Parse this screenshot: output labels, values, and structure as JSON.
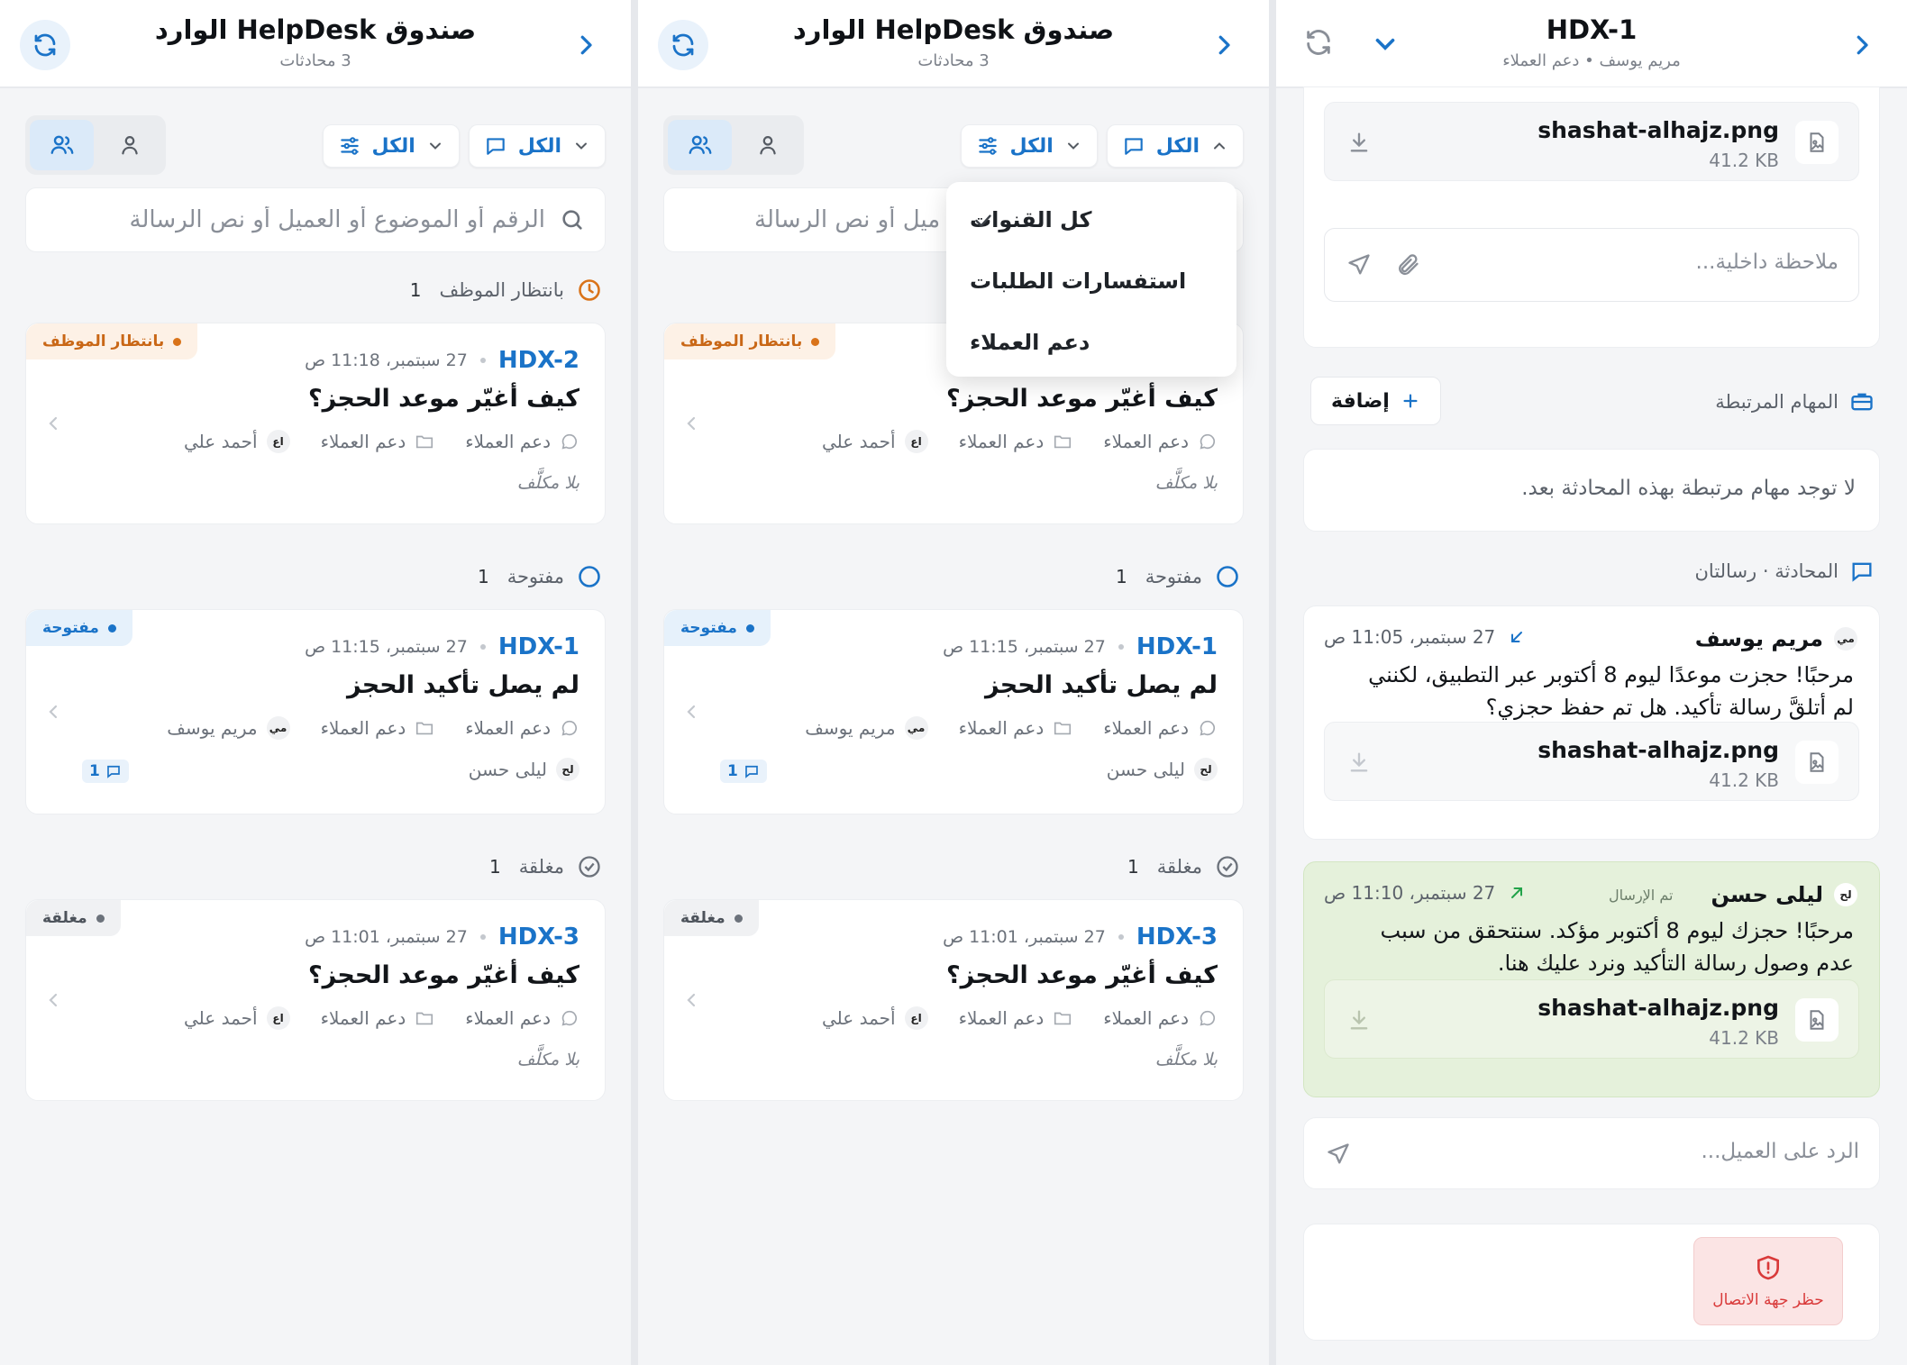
{
  "inbox": {
    "title": "صندوق HelpDesk الوارد",
    "subtitle": "3 محادثات",
    "channel_filter": "الكل",
    "status_filter": "الكل",
    "search_placeholder": "الرقم أو الموضوع أو العميل أو نص الرسالة",
    "search_placeholder_partial": "ميل أو نص الرسالة",
    "sections": [
      {
        "title": "بانتظار الموظف",
        "count": "1"
      },
      {
        "title": "مفتوحة",
        "count": "1"
      },
      {
        "title": "مغلقة",
        "count": "1"
      }
    ],
    "tickets": [
      {
        "id": "HDX-2",
        "time": "27 سبتمبر، 11:18 ص",
        "subject": "كيف أغيّر موعد الحجز؟",
        "channel": "دعم العملاء",
        "folder": "دعم العملاء",
        "customer_initials": "اع",
        "customer": "أحمد علي",
        "assignee": "بلا مكلَّف",
        "badge": "بانتظار الموظف"
      },
      {
        "id": "HDX-1",
        "time": "27 سبتمبر، 11:15 ص",
        "subject": "لم يصل تأكيد الحجز",
        "channel": "دعم العملاء",
        "folder": "دعم العملاء",
        "customer_initials": "مي",
        "customer": "مريم يوسف",
        "assignee_initials": "لح",
        "assignee": "ليلى حسن",
        "comments": "1",
        "badge": "مفتوحة"
      },
      {
        "id": "HDX-3",
        "time": "27 سبتمبر، 11:01 ص",
        "subject": "كيف أغيّر موعد الحجز؟",
        "channel": "دعم العملاء",
        "folder": "دعم العملاء",
        "customer_initials": "اع",
        "customer": "أحمد علي",
        "assignee": "بلا مكلَّف",
        "badge": "مغلقة"
      }
    ]
  },
  "dropdown": {
    "items": [
      "كل القنوات",
      "استفسارات الطلبات",
      "دعم العملاء"
    ]
  },
  "detail": {
    "title": "HDX-1",
    "subtitle": "مريم يوسف • دعم العملاء",
    "top_file": {
      "name": "shashat-alhajz.png",
      "size": "41.2 KB"
    },
    "note_placeholder": "ملاحظة داخلية...",
    "tasks_label": "المهام المرتبطة",
    "add_label": "إضافة",
    "no_tasks": "لا توجد مهام مرتبطة بهذه المحادثة بعد.",
    "conversation_label": "المحادثة · رسالتان",
    "messages": [
      {
        "initials": "مي",
        "name": "مريم يوسف",
        "time": "27 سبتمبر، 11:05 ص",
        "body": "مرحبًا! حجزت موعدًا ليوم 8 أكتوبر عبر التطبيق، لكنني لم أتلقَّ رسالة تأكيد. هل تم حفظ حجزي؟",
        "file": {
          "name": "shashat-alhajz.png",
          "size": "41.2 KB"
        }
      },
      {
        "initials": "لح",
        "name": "ليلى حسن",
        "status": "تم الإرسال",
        "time": "27 سبتمبر، 11:10 ص",
        "body": "مرحبًا! حجزك ليوم 8 أكتوبر مؤكد. سنتحقق من سبب عدم وصول رسالة التأكيد ونرد عليك هنا.",
        "file": {
          "name": "shashat-alhajz.png",
          "size": "41.2 KB"
        }
      }
    ],
    "reply_placeholder": "الرد على العميل...",
    "block_label": "حظر جهة الاتصال"
  },
  "colors": {
    "accent": "#1a73c8",
    "waiting": "#d9731a",
    "open": "#1a73c8",
    "closed": "#6c727b",
    "sent_bg": "#e6f2dc",
    "danger": "#d93a3a"
  }
}
